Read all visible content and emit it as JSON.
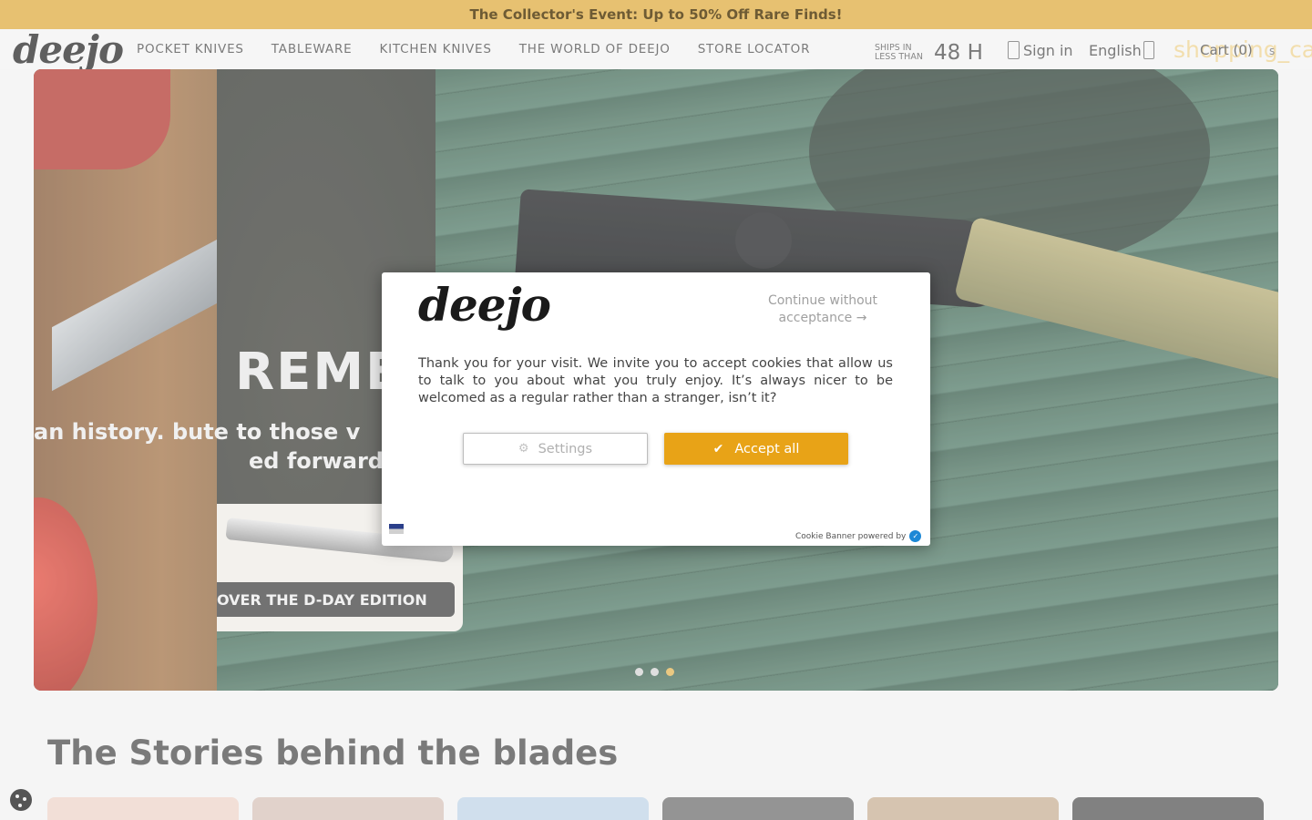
{
  "announcement": "The Collector's Event: Up to 50% Off Rare Finds!",
  "header": {
    "logo": "deejo",
    "nav": [
      "POCKET KNIVES",
      "TABLEWARE",
      "KITCHEN KNIVES",
      "THE WORLD OF DEEJO",
      "STORE LOCATOR"
    ],
    "ships_line1": "SHIPS IN",
    "ships_line2": "LESS THAN",
    "ships_hours": "48 H",
    "signin": "Sign in",
    "language": "English",
    "ghost_text": "shopping_ca",
    "cart": "Cart (0)",
    "cart_suffix": "s"
  },
  "hero": {
    "title": "REME",
    "sub_line1": "an history.      bute to those v",
    "sub_line2": "ed forward, ev",
    "cta": "OVER THE D-DAY EDITION",
    "slide_count": 3,
    "active_slide": 3
  },
  "section": {
    "title": "The Stories behind the blades",
    "thumb_colors": [
      "#efd6cc",
      "#d9c6bd",
      "#c3d7e8",
      "#767676",
      "#cbb49a",
      "#5e5e5e"
    ]
  },
  "cookie": {
    "logo": "deejo",
    "continue": "Continue without acceptance",
    "continue_arrow": "→",
    "text": "Thank you for your visit. We invite you to accept cookies that allow us to talk to you about what you truly enjoy. It’s always nicer to be welcomed as a regular rather than a stranger, isn’t it?",
    "settings": "Settings",
    "accept": "Accept all",
    "powered_by": "Cookie Banner powered by"
  },
  "colors": {
    "accent": "#e4b95e",
    "accept_button": "#e8a317"
  }
}
